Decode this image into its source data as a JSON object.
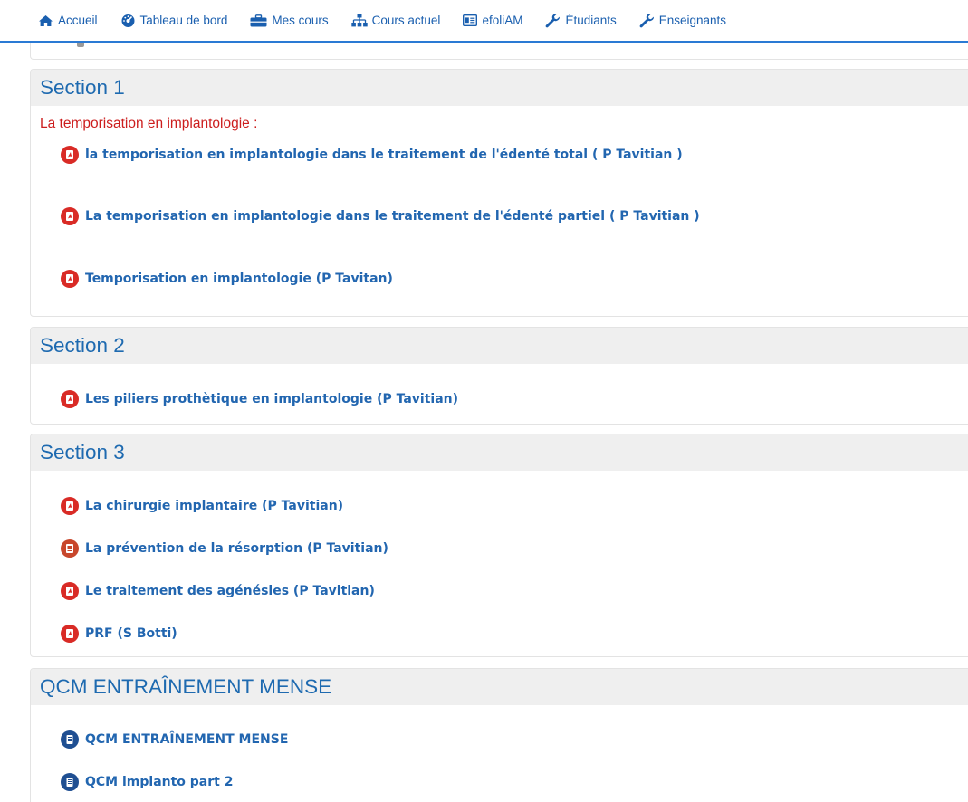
{
  "nav": {
    "items": [
      {
        "label": "Accueil",
        "icon": "home-icon"
      },
      {
        "label": "Tableau de bord",
        "icon": "dashboard-icon"
      },
      {
        "label": "Mes cours",
        "icon": "briefcase-icon"
      },
      {
        "label": "Cours actuel",
        "icon": "sitemap-icon"
      },
      {
        "label": "efoliAM",
        "icon": "id-card-icon"
      },
      {
        "label": "Étudiants",
        "icon": "wrench-icon"
      },
      {
        "label": "Enseignants",
        "icon": "wrench-icon"
      }
    ]
  },
  "colors": {
    "link": "#2266b0",
    "section_title": "#1e6ab0",
    "summary_red": "#cc1d1d",
    "pdf_icon": "#d92b26",
    "quiz_icon": "#1f4f92",
    "nav_border": "#2a7ad4"
  },
  "sections": [
    {
      "title": "Section 1",
      "summary": "La temporisation en implantologie :",
      "activities": [
        {
          "name": "la temporisation en implantologie dans le traitement de l'édenté total ( P Tavitian )",
          "icon": "pdf-icon"
        },
        {
          "name": "La temporisation en implantologie dans le traitement de l'édenté partiel ( P Tavitian )",
          "icon": "pdf-icon"
        },
        {
          "name": "Temporisation en implantologie (P Tavitan)",
          "icon": "pdf-icon"
        }
      ]
    },
    {
      "title": "Section 2",
      "activities": [
        {
          "name": "Les piliers prothètique en implantologie (P Tavitian)",
          "icon": "pdf-icon"
        }
      ]
    },
    {
      "title": "Section 3",
      "activities": [
        {
          "name": "La chirurgie implantaire (P Tavitian)",
          "icon": "pdf-icon"
        },
        {
          "name": "La prévention de la résorption (P Tavitian)",
          "icon": "document-icon"
        },
        {
          "name": "Le traitement des agénésies (P Tavitian)",
          "icon": "pdf-icon"
        },
        {
          "name": "PRF (S Botti)",
          "icon": "pdf-icon"
        }
      ]
    },
    {
      "title": "QCM ENTRAÎNEMENT MENSE",
      "activities": [
        {
          "name": "QCM ENTRAÎNEMENT MENSE",
          "icon": "quiz-icon"
        },
        {
          "name": "QCM implanto part 2",
          "icon": "quiz-icon"
        }
      ]
    }
  ]
}
